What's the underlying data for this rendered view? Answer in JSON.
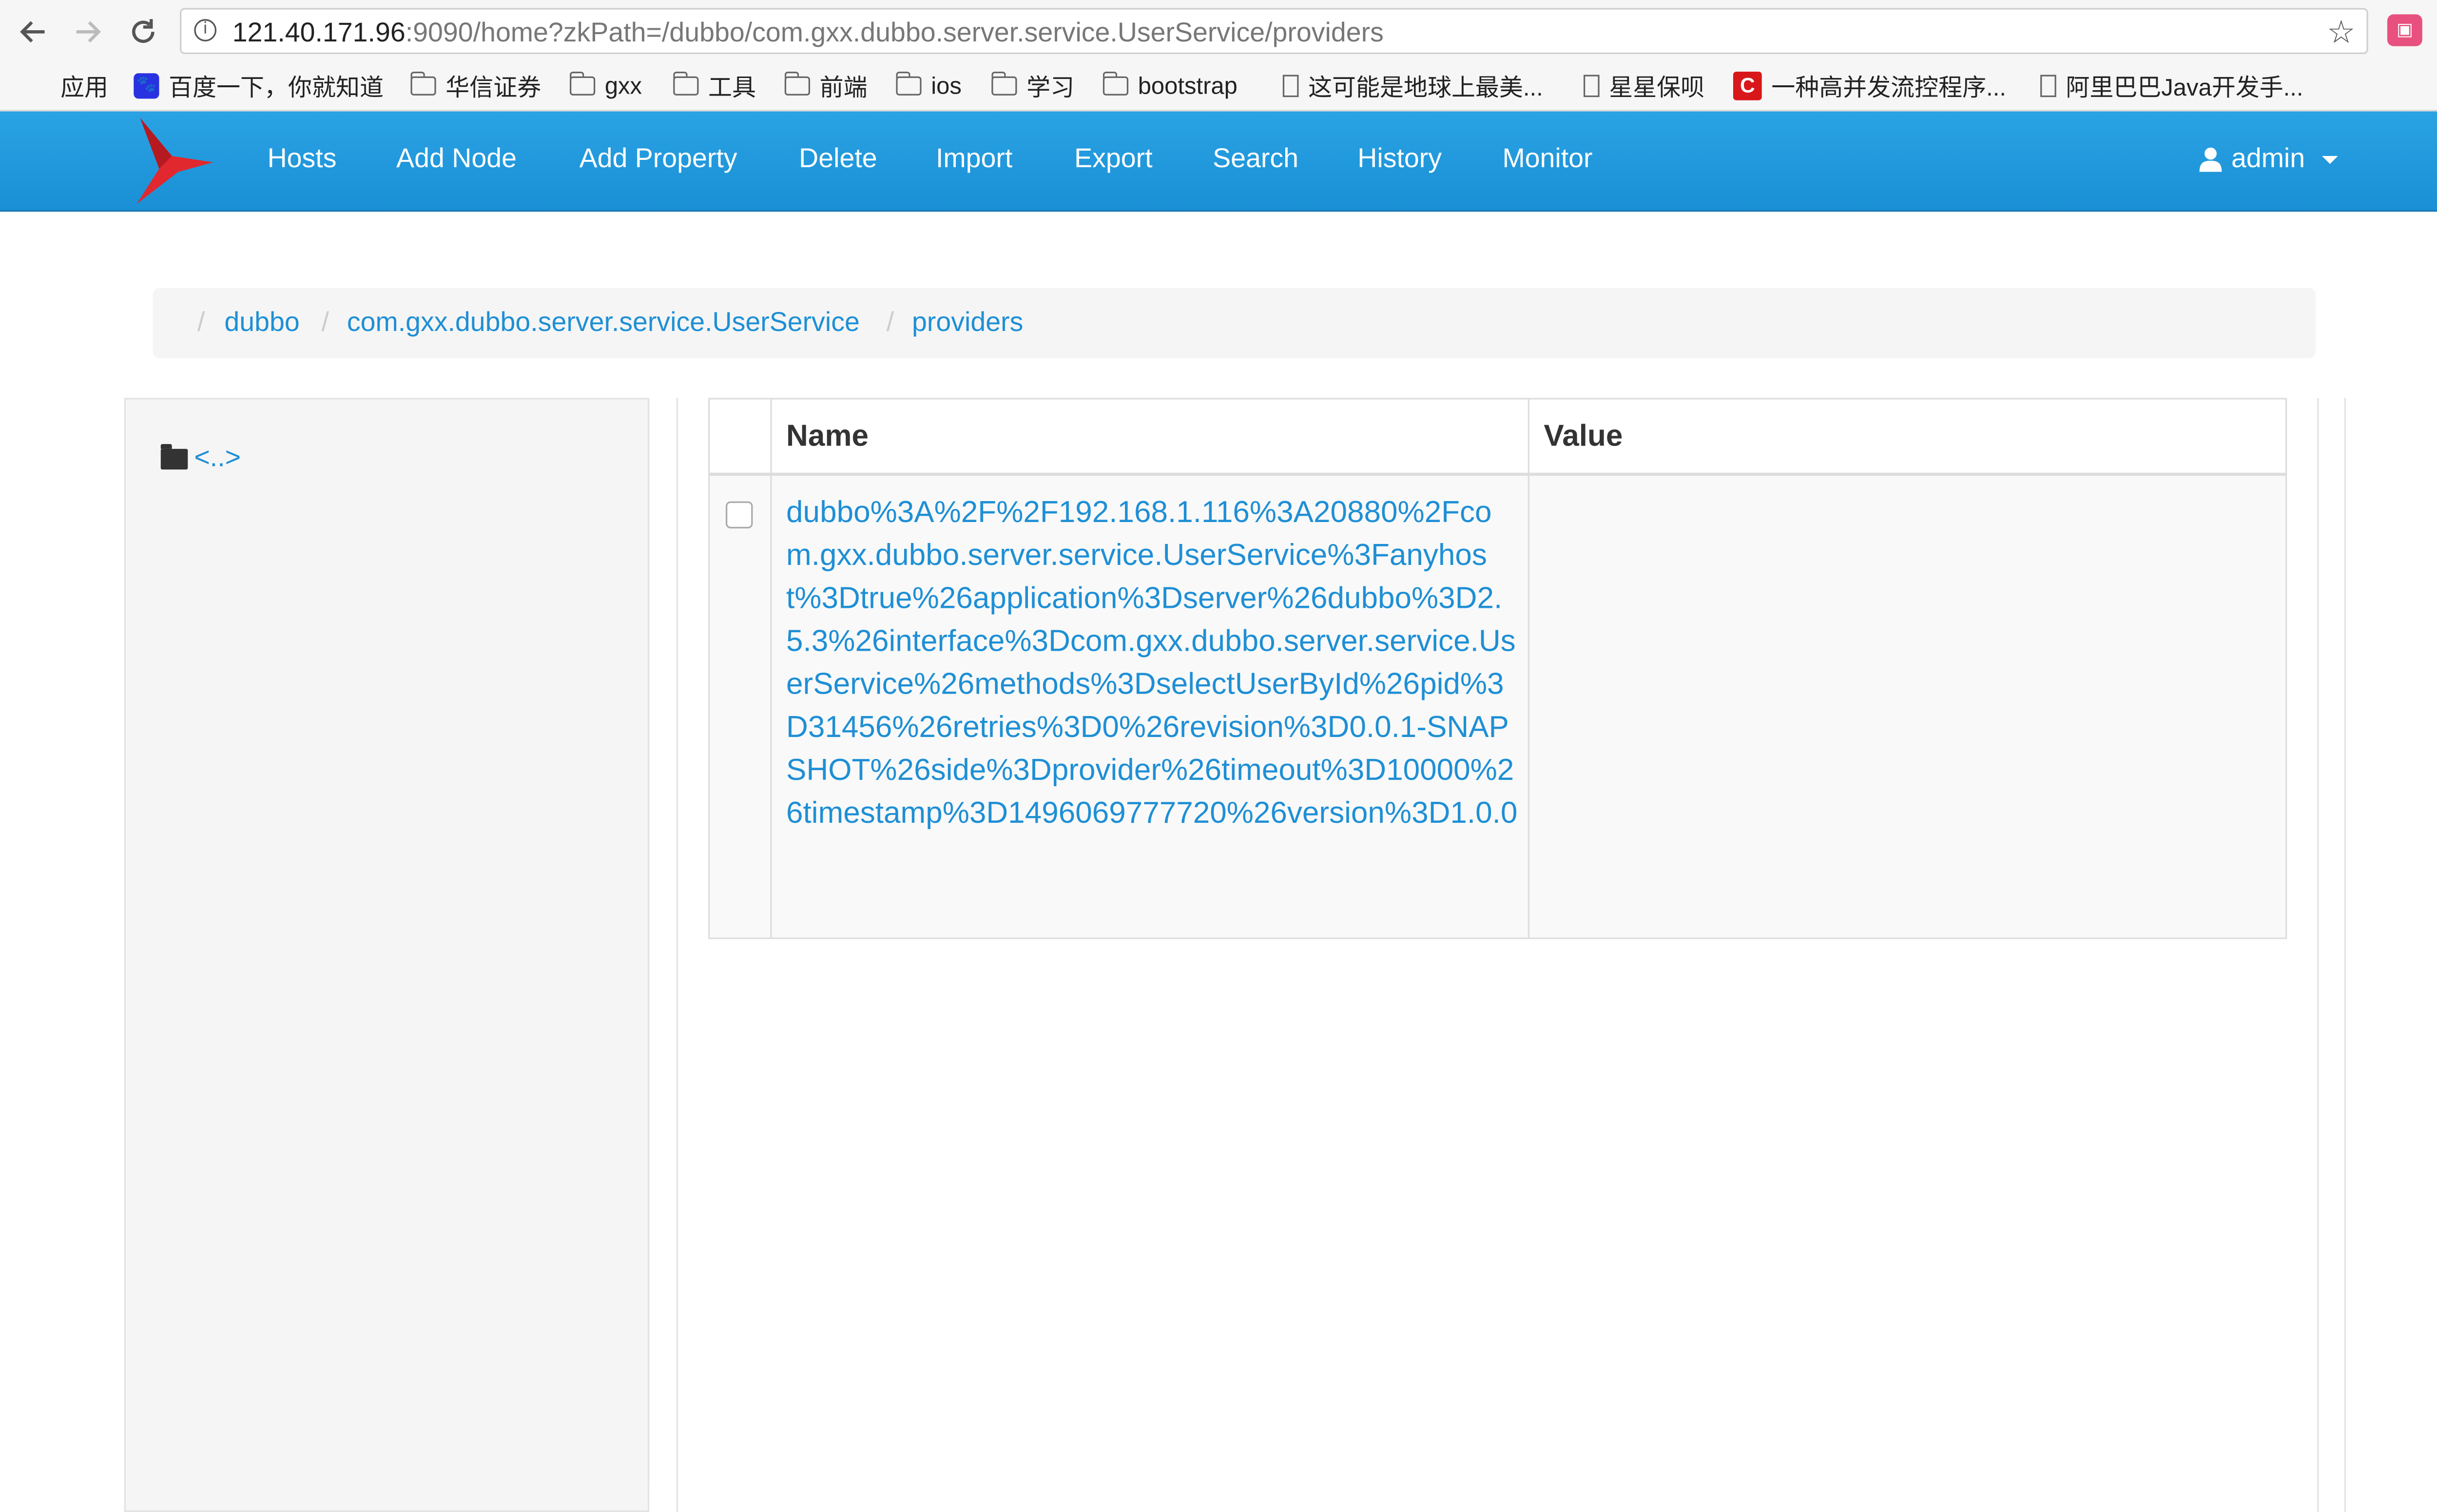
{
  "browser": {
    "url_host": "121.40.171.96",
    "url_rest": ":9090/home?zkPath=/dubbo/com.gxx.dubbo.server.service.UserService/providers",
    "back_icon": "arrow-left-icon",
    "forward_icon": "arrow-right-icon",
    "reload_icon": "reload-icon",
    "bookmarks": [
      {
        "label": "应用",
        "icon": "apps-grid-icon"
      },
      {
        "label": "百度一下，你就知道",
        "icon": "baidu-icon"
      },
      {
        "label": "华信证券",
        "icon": "folder-icon"
      },
      {
        "label": "gxx",
        "icon": "folder-icon"
      },
      {
        "label": "工具",
        "icon": "folder-icon"
      },
      {
        "label": "前端",
        "icon": "folder-icon"
      },
      {
        "label": "ios",
        "icon": "folder-icon"
      },
      {
        "label": "学习",
        "icon": "folder-icon"
      },
      {
        "label": "bootstrap",
        "icon": "folder-icon"
      },
      {
        "label": "这可能是地球上最美...",
        "icon": "page-icon"
      },
      {
        "label": "星星保呗",
        "icon": "page-icon"
      },
      {
        "label": "一种高并发流控程序...",
        "icon": "c-icon"
      },
      {
        "label": "阿里巴巴Java开发手...",
        "icon": "page-icon"
      }
    ],
    "more": "»"
  },
  "navbar": {
    "links": [
      "Hosts",
      "Add Node",
      "Add Property",
      "Delete",
      "Import",
      "Export",
      "Search",
      "History",
      "Monitor"
    ],
    "user": "admin",
    "brand_color": "#e0282e",
    "bar_color": "#1a8fd5"
  },
  "breadcrumb": {
    "sep": "/",
    "items": [
      "dubbo",
      "com.gxx.dubbo.server.service.UserService",
      "providers"
    ]
  },
  "tree": {
    "parent": "<..>"
  },
  "table": {
    "headers": [
      "Name",
      "Value"
    ],
    "rows": [
      {
        "name": "dubbo%3A%2F%2F192.168.1.116%3A20880%2Fcom.gxx.dubbo.server.service.UserService%3Fanyhost%3Dtrue%26application%3Dserver%26dubbo%3D2.5.3%26interface%3Dcom.gxx.dubbo.server.service.UserService%26methods%3DselectUserById%26pid%3D31456%26retries%3D0%26revision%3D0.0.1-SNAPSHOT%26side%3Dprovider%26timeout%3D10000%26timestamp%3D1496069777720%26version%3D1.0.0",
        "value": ""
      }
    ]
  }
}
